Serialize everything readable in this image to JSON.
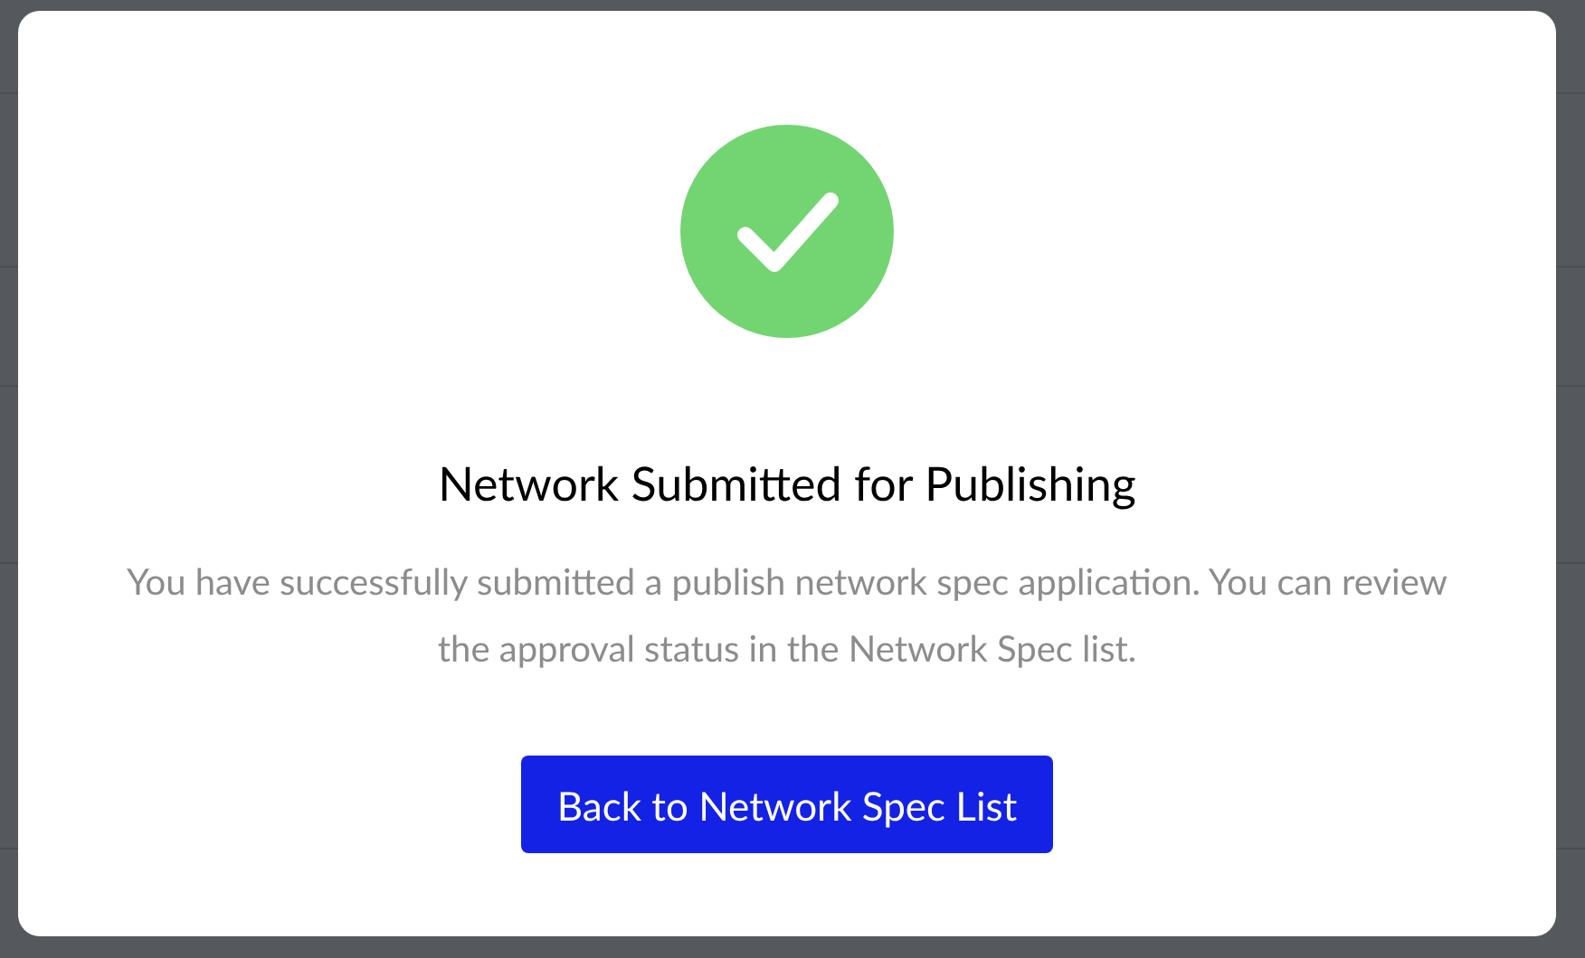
{
  "dialog": {
    "title": "Network Submitted for Publishing",
    "message": "You have successfully submitted a publish network spec application. You can review the approval status in the Network Spec list.",
    "button": "Back to Network Spec List"
  }
}
